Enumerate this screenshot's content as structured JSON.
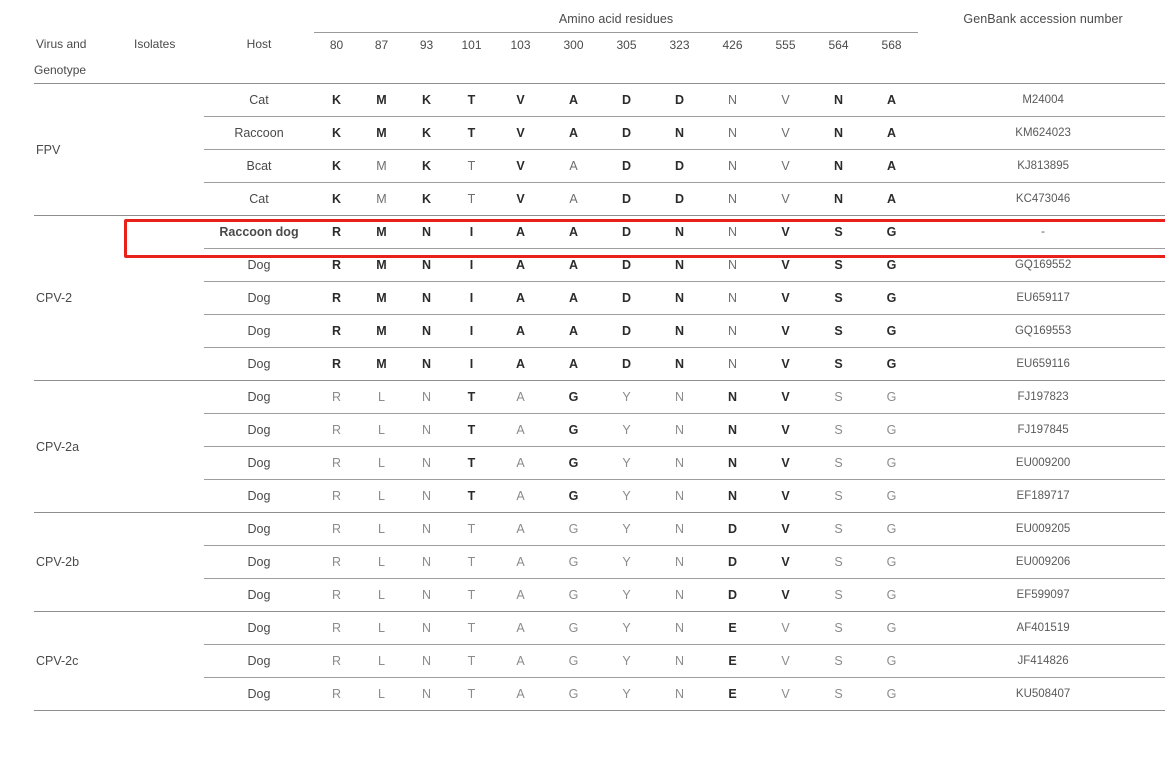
{
  "table": {
    "group_header": "Amino acid residues",
    "accession_header": "GenBank accession number",
    "col_virus_line1": "Virus and",
    "col_virus_line2": "Genotype",
    "col_isolates": "Isolates",
    "col_host": "Host",
    "residue_positions": [
      "80",
      "87",
      "93",
      "101",
      "103",
      "300",
      "305",
      "323",
      "426",
      "555",
      "564",
      "568"
    ],
    "groups": [
      {
        "genotype": "FPV",
        "rows": [
          {
            "host": "Cat",
            "residues": [
              "K",
              "M",
              "K",
              "T",
              "V",
              "A",
              "D",
              "D",
              "N",
              "V",
              "N",
              "A"
            ],
            "bold": [
              0,
              1,
              2,
              3,
              4,
              5,
              6,
              7,
              10,
              11
            ],
            "accession": "M24004"
          },
          {
            "host": "Raccoon",
            "residues": [
              "K",
              "M",
              "K",
              "T",
              "V",
              "A",
              "D",
              "N",
              "N",
              "V",
              "N",
              "A"
            ],
            "bold": [
              0,
              1,
              2,
              3,
              4,
              5,
              6,
              7,
              10,
              11
            ],
            "accession": "KM624023"
          },
          {
            "host": "Bcat",
            "residues": [
              "K",
              "M",
              "K",
              "T",
              "V",
              "A",
              "D",
              "D",
              "N",
              "V",
              "N",
              "A"
            ],
            "bold": [
              0,
              2,
              4,
              6,
              7,
              10,
              11
            ],
            "accession": "KJ813895"
          },
          {
            "host": "Cat",
            "residues": [
              "K",
              "M",
              "K",
              "T",
              "V",
              "A",
              "D",
              "D",
              "N",
              "V",
              "N",
              "A"
            ],
            "bold": [
              0,
              2,
              4,
              6,
              7,
              10,
              11
            ],
            "accession": "KC473046"
          }
        ]
      },
      {
        "genotype": "CPV-2",
        "rows": [
          {
            "host": "Raccoon dog",
            "residues": [
              "R",
              "M",
              "N",
              "I",
              "A",
              "A",
              "D",
              "N",
              "N",
              "V",
              "S",
              "G"
            ],
            "bold": [
              0,
              1,
              2,
              3,
              4,
              5,
              6,
              7,
              9,
              10,
              11
            ],
            "accession": "-",
            "highlight": true,
            "host_bold": true
          },
          {
            "host": "Dog",
            "residues": [
              "R",
              "M",
              "N",
              "I",
              "A",
              "A",
              "D",
              "N",
              "N",
              "V",
              "S",
              "G"
            ],
            "bold": [
              0,
              1,
              2,
              3,
              4,
              5,
              6,
              7,
              9,
              10,
              11
            ],
            "accession": "GQ169552"
          },
          {
            "host": "Dog",
            "residues": [
              "R",
              "M",
              "N",
              "I",
              "A",
              "A",
              "D",
              "N",
              "N",
              "V",
              "S",
              "G"
            ],
            "bold": [
              0,
              1,
              2,
              3,
              4,
              5,
              6,
              7,
              9,
              10,
              11
            ],
            "accession": "EU659117"
          },
          {
            "host": "Dog",
            "residues": [
              "R",
              "M",
              "N",
              "I",
              "A",
              "A",
              "D",
              "N",
              "N",
              "V",
              "S",
              "G"
            ],
            "bold": [
              0,
              1,
              2,
              3,
              4,
              5,
              6,
              7,
              9,
              10,
              11
            ],
            "accession": "GQ169553"
          },
          {
            "host": "Dog",
            "residues": [
              "R",
              "M",
              "N",
              "I",
              "A",
              "A",
              "D",
              "N",
              "N",
              "V",
              "S",
              "G"
            ],
            "bold": [
              0,
              1,
              2,
              3,
              4,
              5,
              6,
              7,
              9,
              10,
              11
            ],
            "accession": "EU659116"
          }
        ]
      },
      {
        "genotype": "CPV-2a",
        "rows": [
          {
            "host": "Dog",
            "residues": [
              "R",
              "L",
              "N",
              "T",
              "A",
              "G",
              "Y",
              "N",
              "N",
              "V",
              "S",
              "G"
            ],
            "bold": [
              3,
              5,
              8,
              9
            ],
            "accession": "FJ197823"
          },
          {
            "host": "Dog",
            "residues": [
              "R",
              "L",
              "N",
              "T",
              "A",
              "G",
              "Y",
              "N",
              "N",
              "V",
              "S",
              "G"
            ],
            "bold": [
              3,
              5,
              8,
              9
            ],
            "accession": "FJ197845"
          },
          {
            "host": "Dog",
            "residues": [
              "R",
              "L",
              "N",
              "T",
              "A",
              "G",
              "Y",
              "N",
              "N",
              "V",
              "S",
              "G"
            ],
            "bold": [
              3,
              5,
              8,
              9
            ],
            "accession": "EU009200"
          },
          {
            "host": "Dog",
            "residues": [
              "R",
              "L",
              "N",
              "T",
              "A",
              "G",
              "Y",
              "N",
              "N",
              "V",
              "S",
              "G"
            ],
            "bold": [
              3,
              5,
              8,
              9
            ],
            "accession": "EF189717"
          }
        ]
      },
      {
        "genotype": "CPV-2b",
        "rows": [
          {
            "host": "Dog",
            "residues": [
              "R",
              "L",
              "N",
              "T",
              "A",
              "G",
              "Y",
              "N",
              "D",
              "V",
              "S",
              "G"
            ],
            "bold": [
              8,
              9
            ],
            "accession": "EU009205"
          },
          {
            "host": "Dog",
            "residues": [
              "R",
              "L",
              "N",
              "T",
              "A",
              "G",
              "Y",
              "N",
              "D",
              "V",
              "S",
              "G"
            ],
            "bold": [
              8,
              9
            ],
            "accession": "EU009206"
          },
          {
            "host": "Dog",
            "residues": [
              "R",
              "L",
              "N",
              "T",
              "A",
              "G",
              "Y",
              "N",
              "D",
              "V",
              "S",
              "G"
            ],
            "bold": [
              8,
              9
            ],
            "accession": "EF599097"
          }
        ]
      },
      {
        "genotype": "CPV-2c",
        "rows": [
          {
            "host": "Dog",
            "residues": [
              "R",
              "L",
              "N",
              "T",
              "A",
              "G",
              "Y",
              "N",
              "E",
              "V",
              "S",
              "G"
            ],
            "bold": [
              8
            ],
            "accession": "AF401519"
          },
          {
            "host": "Dog",
            "residues": [
              "R",
              "L",
              "N",
              "T",
              "A",
              "G",
              "Y",
              "N",
              "E",
              "V",
              "S",
              "G"
            ],
            "bold": [
              8
            ],
            "accession": "JF414826"
          },
          {
            "host": "Dog",
            "residues": [
              "R",
              "L",
              "N",
              "T",
              "A",
              "G",
              "Y",
              "N",
              "E",
              "V",
              "S",
              "G"
            ],
            "bold": [
              8
            ],
            "accession": "KU508407"
          }
        ]
      }
    ],
    "highlight_color": "#e8211b"
  }
}
